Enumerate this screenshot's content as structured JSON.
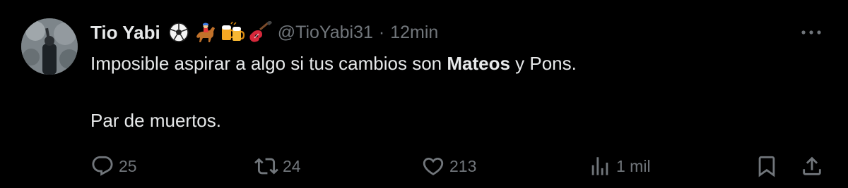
{
  "tweet": {
    "display_name": "Tio Yabi",
    "name_emojis": [
      "soccer-ball-icon",
      "horse-racing-icon",
      "beer-mugs-icon",
      "guitar-icon"
    ],
    "handle": "@TioYabi31",
    "separator": "·",
    "timestamp": "12min",
    "body": {
      "line1_before": "Imposible aspirar a algo si tus cambios son ",
      "line1_bold": "Mateos",
      "line1_after": " y Pons.",
      "line2": "Par de muertos."
    },
    "actions": {
      "replies": "25",
      "reposts": "24",
      "likes": "213",
      "views": "1 mil"
    }
  },
  "colors": {
    "background": "#000000",
    "primary_text": "#e7e9ea",
    "secondary_text": "#71767b"
  }
}
